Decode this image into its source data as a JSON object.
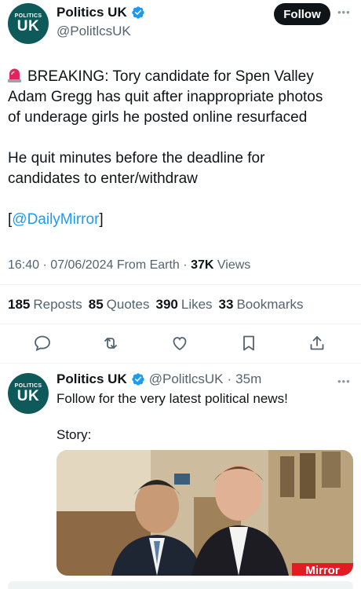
{
  "tweet": {
    "avatar": {
      "top_text": "POLITICS",
      "main_text": "UK",
      "bg_color": "#0e5a5a"
    },
    "display_name": "Politics UK",
    "handle": "@PolitlcsUK",
    "follow_label": "Follow",
    "more_icon": "more-horizontal-icon",
    "line1": "BREAKING: Tory candidate for Spen Valley",
    "line2": "Adam Gregg has quit after inappropriate photos",
    "line3": "of underage girls he posted online resurfaced",
    "line4": "He quit minutes before the deadline for",
    "line5": "candidates to enter/withdraw",
    "link_open": "[",
    "link_text": "@DailyMirror",
    "link_close": "]",
    "time": "16:40",
    "sep1": "·",
    "date": "07/06/2024",
    "source": "From Earth",
    "sep2": "·",
    "views_count": "37K",
    "views_label": "Views"
  },
  "stats": {
    "reposts_count": "185",
    "reposts_label": "Reposts",
    "quotes_count": "85",
    "quotes_label": "Quotes",
    "likes_count": "390",
    "likes_label": "Likes",
    "bookmarks_count": "33",
    "bookmarks_label": "Bookmarks"
  },
  "actions": [
    "reply-icon",
    "repost-icon",
    "like-icon",
    "bookmark-icon",
    "share-icon"
  ],
  "reply": {
    "display_name": "Politics UK",
    "handle": "@PolitlcsUK",
    "sep": "·",
    "time_ago": "35m",
    "line1": "Follow for the very latest political news!",
    "line2": "Story:",
    "photo_watermark": "Mirror"
  },
  "colors": {
    "accent": "#1d9bf0",
    "verified": "#1d9bf0",
    "text": "#0f1419",
    "muted": "#536471"
  }
}
